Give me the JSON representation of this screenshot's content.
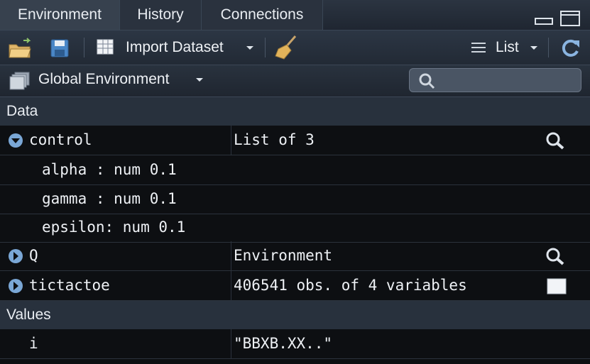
{
  "tabs": [
    {
      "label": "Environment",
      "active": true
    },
    {
      "label": "History",
      "active": false
    },
    {
      "label": "Connections",
      "active": false
    }
  ],
  "toolbar": {
    "import_label": "Import Dataset",
    "view_label": "List"
  },
  "env": {
    "scope_label": "Global Environment",
    "search_placeholder": ""
  },
  "sections": {
    "data": "Data",
    "values": "Values"
  },
  "data_rows": [
    {
      "name": "control",
      "value": "List of 3",
      "expanded": true,
      "icon": "magnifier-icon"
    },
    {
      "name": "Q",
      "value": "Environment",
      "expanded": false,
      "icon": "magnifier-icon"
    },
    {
      "name": "tictactoe",
      "value": "406541 obs. of 4 variables",
      "expanded": false,
      "icon": "table-grid-icon"
    }
  ],
  "control_children": [
    "alpha : num 0.1",
    "gamma : num 0.1",
    "epsilon: num 0.1"
  ],
  "values_rows": [
    {
      "name": "i",
      "value": "\"BBXB.XX..\""
    }
  ],
  "colors": {
    "accent": "#7aa7d6",
    "panel_bg": "#0d0f12",
    "header_bg": "#28313d"
  }
}
